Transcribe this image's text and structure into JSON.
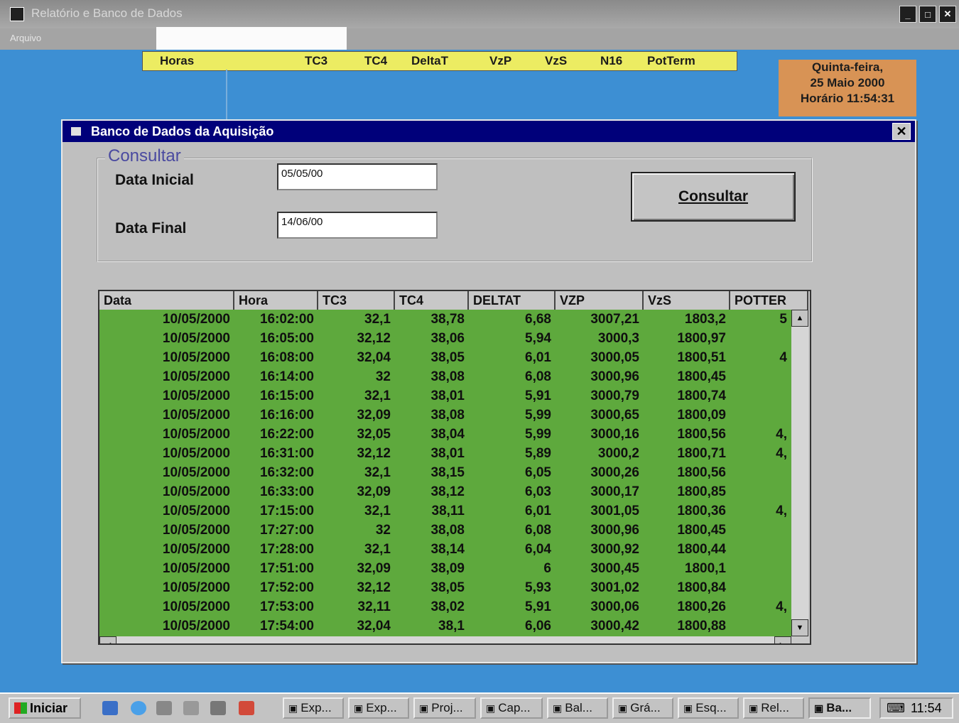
{
  "window": {
    "title": "Relatório e Banco de Dados",
    "controls": [
      "_",
      "□",
      "✕"
    ]
  },
  "menu": {
    "item": "Arquivo"
  },
  "live_header": {
    "columns": [
      "Horas",
      "TC3",
      "TC4",
      "DeltaT",
      "VzP",
      "VzS",
      "N16",
      "PotTerm"
    ]
  },
  "date_panel": {
    "line1": "Quinta-feira,",
    "line2": "25 Maio 2000",
    "line3": "Horário 11:54:31"
  },
  "dialog": {
    "title": "Banco de Dados da Aquisição",
    "close_label": "✕",
    "group_label": "Consultar",
    "start_label": "Data Inicial",
    "start_value": "05/05/00",
    "end_label": "Data Final",
    "end_value": "14/06/00",
    "button_label": "Consultar"
  },
  "grid": {
    "columns": [
      "Data",
      "Hora",
      "TC3",
      "TC4",
      "DELTAT",
      "VZP",
      "VzS",
      "POTTER"
    ],
    "rows": [
      [
        "10/05/2000",
        "16:02:00",
        "32,1",
        "38,78",
        "6,68",
        "3007,21",
        "1803,2",
        "5"
      ],
      [
        "10/05/2000",
        "16:05:00",
        "32,12",
        "38,06",
        "5,94",
        "3000,3",
        "1800,97",
        ""
      ],
      [
        "10/05/2000",
        "16:08:00",
        "32,04",
        "38,05",
        "6,01",
        "3000,05",
        "1800,51",
        "4"
      ],
      [
        "10/05/2000",
        "16:14:00",
        "32",
        "38,08",
        "6,08",
        "3000,96",
        "1800,45",
        ""
      ],
      [
        "10/05/2000",
        "16:15:00",
        "32,1",
        "38,01",
        "5,91",
        "3000,79",
        "1800,74",
        ""
      ],
      [
        "10/05/2000",
        "16:16:00",
        "32,09",
        "38,08",
        "5,99",
        "3000,65",
        "1800,09",
        ""
      ],
      [
        "10/05/2000",
        "16:22:00",
        "32,05",
        "38,04",
        "5,99",
        "3000,16",
        "1800,56",
        "4,"
      ],
      [
        "10/05/2000",
        "16:31:00",
        "32,12",
        "38,01",
        "5,89",
        "3000,2",
        "1800,71",
        "4,"
      ],
      [
        "10/05/2000",
        "16:32:00",
        "32,1",
        "38,15",
        "6,05",
        "3000,26",
        "1800,56",
        ""
      ],
      [
        "10/05/2000",
        "16:33:00",
        "32,09",
        "38,12",
        "6,03",
        "3000,17",
        "1800,85",
        ""
      ],
      [
        "10/05/2000",
        "17:15:00",
        "32,1",
        "38,11",
        "6,01",
        "3001,05",
        "1800,36",
        "4,"
      ],
      [
        "10/05/2000",
        "17:27:00",
        "32",
        "38,08",
        "6,08",
        "3000,96",
        "1800,45",
        ""
      ],
      [
        "10/05/2000",
        "17:28:00",
        "32,1",
        "38,14",
        "6,04",
        "3000,92",
        "1800,44",
        ""
      ],
      [
        "10/05/2000",
        "17:51:00",
        "32,09",
        "38,09",
        "6",
        "3000,45",
        "1800,1",
        ""
      ],
      [
        "10/05/2000",
        "17:52:00",
        "32,12",
        "38,05",
        "5,93",
        "3001,02",
        "1800,84",
        ""
      ],
      [
        "10/05/2000",
        "17:53:00",
        "32,11",
        "38,02",
        "5,91",
        "3000,06",
        "1800,26",
        "4,"
      ],
      [
        "10/05/2000",
        "17:54:00",
        "32,04",
        "38,1",
        "6,06",
        "3000,42",
        "1800,88",
        ""
      ]
    ]
  },
  "taskbar": {
    "start_label": "Iniciar",
    "buttons": [
      "Exp...",
      "Exp...",
      "Proj...",
      "Cap...",
      "Bal...",
      "Grá...",
      "Esq...",
      "Rel...",
      "Ba..."
    ],
    "clock": "11:54"
  },
  "colors": {
    "desktop": "#3d8fd3",
    "grid_rows": "#5ea93d",
    "header_yellow": "#ecec62",
    "date_orange": "#d89355",
    "dialog_title": "#00007a"
  }
}
